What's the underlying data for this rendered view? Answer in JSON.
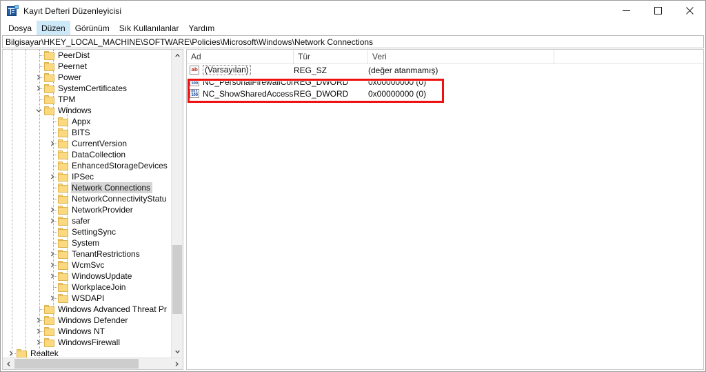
{
  "window": {
    "title": "Kayıt Defteri Düzenleyicisi",
    "icon": "registry-editor-icon",
    "controls": {
      "minimize": "minimize-icon",
      "maximize": "maximize-icon",
      "close": "close-icon"
    }
  },
  "menu": {
    "items": [
      {
        "label": "Dosya",
        "active": false
      },
      {
        "label": "Düzen",
        "active": true
      },
      {
        "label": "Görünüm",
        "active": false
      },
      {
        "label": "Sık Kullanılanlar",
        "active": false
      },
      {
        "label": "Yardım",
        "active": false
      }
    ]
  },
  "address": {
    "path": "Bilgisayar\\HKEY_LOCAL_MACHINE\\SOFTWARE\\Policies\\Microsoft\\Windows\\Network Connections"
  },
  "tree": {
    "nodes": [
      {
        "label": "PeerDist",
        "indent": 4,
        "twist": "none",
        "selected": false
      },
      {
        "label": "Peernet",
        "indent": 4,
        "twist": "none",
        "selected": false
      },
      {
        "label": "Power",
        "indent": 4,
        "twist": "collapsed",
        "selected": false
      },
      {
        "label": "SystemCertificates",
        "indent": 4,
        "twist": "collapsed",
        "selected": false
      },
      {
        "label": "TPM",
        "indent": 4,
        "twist": "none",
        "selected": false
      },
      {
        "label": "Windows",
        "indent": 4,
        "twist": "expanded",
        "selected": false
      },
      {
        "label": "Appx",
        "indent": 5,
        "twist": "none",
        "selected": false
      },
      {
        "label": "BITS",
        "indent": 5,
        "twist": "none",
        "selected": false
      },
      {
        "label": "CurrentVersion",
        "indent": 5,
        "twist": "collapsed",
        "selected": false
      },
      {
        "label": "DataCollection",
        "indent": 5,
        "twist": "none",
        "selected": false
      },
      {
        "label": "EnhancedStorageDevices",
        "indent": 5,
        "twist": "none",
        "selected": false
      },
      {
        "label": "IPSec",
        "indent": 5,
        "twist": "collapsed",
        "selected": false
      },
      {
        "label": "Network Connections",
        "indent": 5,
        "twist": "none",
        "selected": true
      },
      {
        "label": "NetworkConnectivityStatu",
        "indent": 5,
        "twist": "none",
        "selected": false
      },
      {
        "label": "NetworkProvider",
        "indent": 5,
        "twist": "collapsed",
        "selected": false
      },
      {
        "label": "safer",
        "indent": 5,
        "twist": "collapsed",
        "selected": false
      },
      {
        "label": "SettingSync",
        "indent": 5,
        "twist": "none",
        "selected": false
      },
      {
        "label": "System",
        "indent": 5,
        "twist": "none",
        "selected": false
      },
      {
        "label": "TenantRestrictions",
        "indent": 5,
        "twist": "collapsed",
        "selected": false
      },
      {
        "label": "WcmSvc",
        "indent": 5,
        "twist": "collapsed",
        "selected": false
      },
      {
        "label": "WindowsUpdate",
        "indent": 5,
        "twist": "collapsed",
        "selected": false
      },
      {
        "label": "WorkplaceJoin",
        "indent": 5,
        "twist": "none",
        "selected": false
      },
      {
        "label": "WSDAPI",
        "indent": 5,
        "twist": "collapsed",
        "selected": false
      },
      {
        "label": "Windows Advanced Threat Pr",
        "indent": 4,
        "twist": "none",
        "selected": false
      },
      {
        "label": "Windows Defender",
        "indent": 4,
        "twist": "collapsed",
        "selected": false
      },
      {
        "label": "Windows NT",
        "indent": 4,
        "twist": "collapsed",
        "selected": false
      },
      {
        "label": "WindowsFirewall",
        "indent": 4,
        "twist": "collapsed",
        "selected": false
      },
      {
        "label": "Realtek",
        "indent": 2,
        "twist": "collapsed",
        "selected": false
      }
    ]
  },
  "list": {
    "columns": [
      "Ad",
      "Tür",
      "Veri"
    ],
    "rows": [
      {
        "name": "(Varsayılan)",
        "type": "REG_SZ",
        "data": "(değer atanmamış)",
        "icon": "string-value-icon",
        "icon_glyph": "ab",
        "focused": true
      },
      {
        "name": "NC_PersonalFirewallConfig",
        "type": "REG_DWORD",
        "data": "0x00000000 (0)",
        "icon": "dword-value-icon",
        "icon_glyph": "011\n100",
        "focused": false
      },
      {
        "name": "NC_ShowSharedAccessUI",
        "type": "REG_DWORD",
        "data": "0x00000000 (0)",
        "icon": "dword-value-icon",
        "icon_glyph": "011\n100",
        "focused": false
      }
    ]
  },
  "annotation": {
    "color": "#f01010",
    "shape": "rectangle",
    "covers": "NC_PersonalFirewallConfig and NC_ShowSharedAccessUI rows"
  }
}
